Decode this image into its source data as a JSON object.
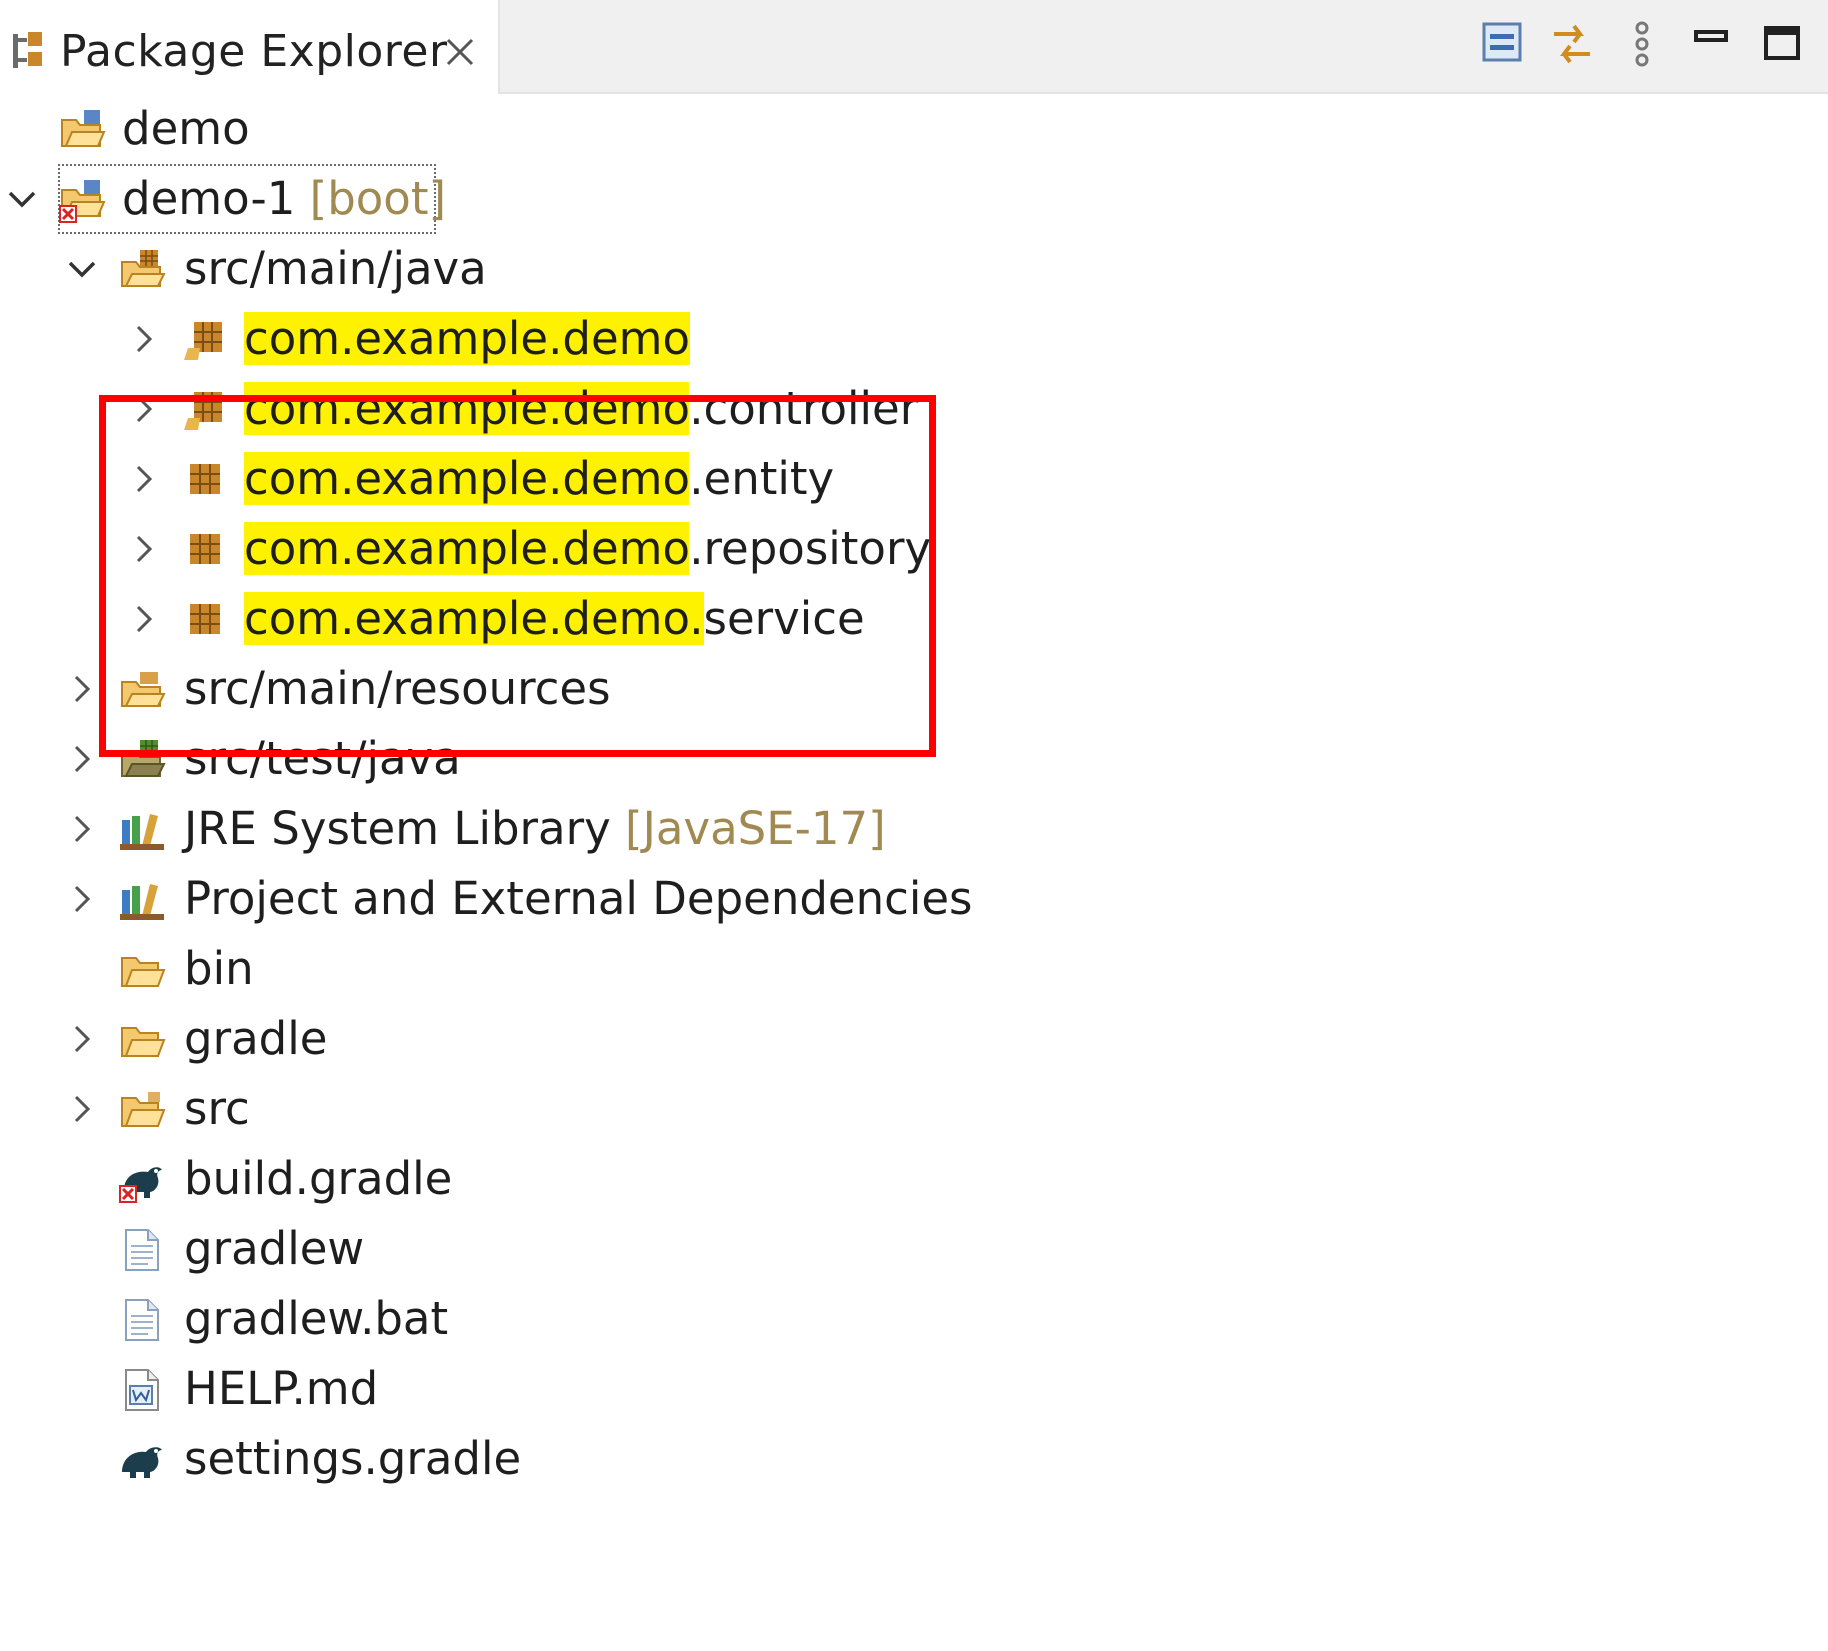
{
  "view": {
    "title": "Package Explorer",
    "toolbar": [
      "collapse-all-icon",
      "link-with-editor-icon",
      "view-menu-icon",
      "minimize-icon",
      "maximize-icon"
    ]
  },
  "tree": {
    "demo": "demo",
    "demo1": {
      "name": "demo-1",
      "decoration": "[boot]"
    },
    "src_main_java": "src/main/java",
    "packages": [
      {
        "match": "com.example.demo",
        "rest": ""
      },
      {
        "match": "com.example.demo",
        "rest": ".controller"
      },
      {
        "match": "com.example.demo",
        "rest": ".entity"
      },
      {
        "match": "com.example.demo",
        "rest": ".repository"
      },
      {
        "match": "com.example.demo.",
        "rest": "service"
      }
    ],
    "src_main_resources": "src/main/resources",
    "src_test_java": "src/test/java",
    "jre": {
      "name": "JRE System Library",
      "decoration": "[JavaSE-17]"
    },
    "deps": "Project and External Dependencies",
    "bin": "bin",
    "gradle": "gradle",
    "src": "src",
    "build_gradle": "build.gradle",
    "gradlew": "gradlew",
    "gradlew_bat": "gradlew.bat",
    "help_md": "HELP.md",
    "settings_gradle": "settings.gradle"
  },
  "colors": {
    "search_highlight": "#fff200",
    "annotation_frame": "#ff0000",
    "decoration_text": "#a08a52"
  }
}
